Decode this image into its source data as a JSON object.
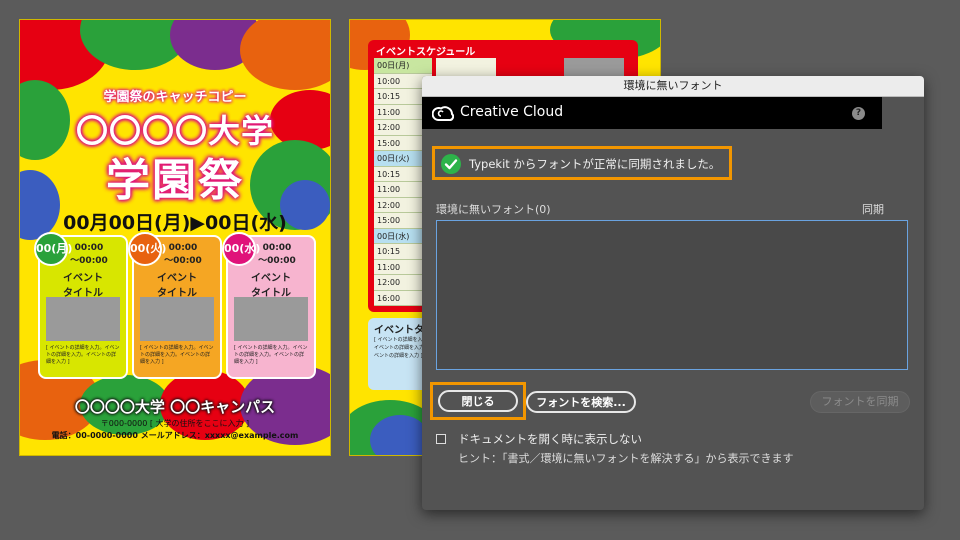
{
  "poster_front": {
    "catch_copy": "学園祭のキャッチコピー",
    "university": "〇〇〇〇大学",
    "festival": "学園祭",
    "date": "00月00日(月)▶00日(水)",
    "cards": [
      {
        "badge": "00(月)",
        "time1": "00:00",
        "time2": "〜00:00",
        "title1": "イベント",
        "title2": "タイトル",
        "desc": "[ イベントの詳細を入力。イベントの詳細を入力。イベントの詳細を入力 ]",
        "color": "#d8e600",
        "badge_color": "#2aa13a"
      },
      {
        "badge": "00(火)",
        "time1": "00:00",
        "time2": "〜00:00",
        "title1": "イベント",
        "title2": "タイトル",
        "desc": "[ イベントの詳細を入力。イベントの詳細を入力。イベントの詳細を入力 ]",
        "color": "#f5a623",
        "badge_color": "#e8620f"
      },
      {
        "badge": "00(水)",
        "time1": "00:00",
        "time2": "〜00:00",
        "title1": "イベント",
        "title2": "タイトル",
        "desc": "[ イベントの詳細を入力。イベントの詳細を入力。イベントの詳細を入力 ]",
        "color": "#f7b4cf",
        "badge_color": "#e0137a"
      }
    ],
    "campus": "〇〇〇〇大学 〇〇キャンパス",
    "address": "〒000-0000 [ 大学の住所をここに入力 ]",
    "contact": "電話：00-0000-0000 メールアドレス：xxxxx@example.com"
  },
  "poster_back": {
    "schedule_title": "イベントスケジュール",
    "rows": [
      "00日(月)",
      "10:00",
      "10:15",
      "11:00",
      "12:00",
      "15:00",
      "00日(火)",
      "10:15",
      "11:00",
      "12:00",
      "15:00",
      "00日(水)",
      "10:15",
      "11:00",
      "12:00",
      "16:00"
    ],
    "target_title": "イベントタ",
    "target_desc": "[ イベントの詳細を入力。イベントの詳細を入力。イベントの詳細を入力 ]"
  },
  "dialog": {
    "window_title": "環境に無いフォント",
    "brand": "Creative Cloud",
    "help": "?",
    "sync_message": "Typekit からフォントが正常に同期されました。",
    "missing_fonts_label": "環境に無いフォント(0)",
    "sync_column_label": "同期",
    "close_button": "閉じる",
    "find_font_button": "フォントを検索...",
    "sync_fonts_button": "フォントを同期",
    "dont_show_label": "ドキュメントを開く時に表示しない",
    "hint": "ヒント：「書式／環境に無いフォントを解決する」から表示できます",
    "colors": {
      "highlight": "#f29600",
      "success": "#2db34a",
      "list_border": "#6aa3e0"
    }
  }
}
